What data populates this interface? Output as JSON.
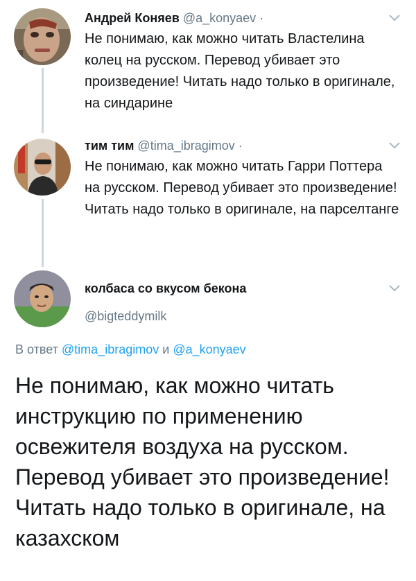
{
  "tweets": [
    {
      "name": "Андрей Коняев",
      "handle": "@a_konyaev",
      "separator": "·",
      "text": "Не понимаю, как можно читать Властелина колец на русском. Перевод убивает это произведение! Читать надо только в оригинале, на синдарине",
      "avatar_icon": "avatar-painted-face"
    },
    {
      "name": "тим тим",
      "handle": "@tima_ibragimov",
      "separator": "·",
      "text": "Не понимаю, как можно читать Гарри Поттера на русском. Перевод убивает это произведение! Читать надо только в оригинале, на парселтанге",
      "avatar_icon": "avatar-man-sunglasses"
    }
  ],
  "main_tweet": {
    "name": "колбаса со вкусом бекона",
    "handle": "@bigteddymilk",
    "reply_prefix": "В ответ",
    "reply_user_1": "@tima_ibragimov",
    "reply_and": "и",
    "reply_user_2": "@a_konyaev",
    "text": "Не понимаю, как можно читать инструкцию по применению освежителя воздуха на русском. Перевод убивает это произведение! Читать надо только в оригинале, на казахском",
    "avatar_icon": "avatar-man-lying"
  },
  "colors": {
    "text": "#14171a",
    "secondary": "#657786",
    "link": "#1da1f2",
    "thread_line": "#ccd6dd"
  }
}
